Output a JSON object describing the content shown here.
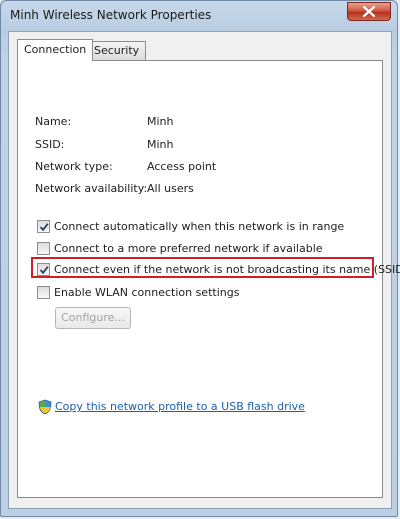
{
  "window": {
    "title": "Minh Wireless Network Properties"
  },
  "tabs": [
    {
      "label": "Connection",
      "active": true
    },
    {
      "label": "Security",
      "active": false
    }
  ],
  "info": [
    {
      "label": "Name:",
      "value": "Minh"
    },
    {
      "label": "SSID:",
      "value": "Minh"
    },
    {
      "label": "Network type:",
      "value": "Access point"
    },
    {
      "label": "Network availability:",
      "value": "All users"
    }
  ],
  "options": [
    {
      "label": "Connect automatically when this network is in range",
      "checked": true
    },
    {
      "label": "Connect to a more preferred network if available",
      "checked": false
    },
    {
      "label": "Connect even if the network is not broadcasting its name (SSID)",
      "checked": true
    },
    {
      "label": "Enable WLAN connection settings",
      "checked": false
    }
  ],
  "configure_button": "Configure...",
  "link": {
    "text": "Copy this network profile to a USB flash drive"
  },
  "colors": {
    "highlight": "#d11f2a",
    "link": "#1c5fa8",
    "close_button": "#c74a33"
  }
}
